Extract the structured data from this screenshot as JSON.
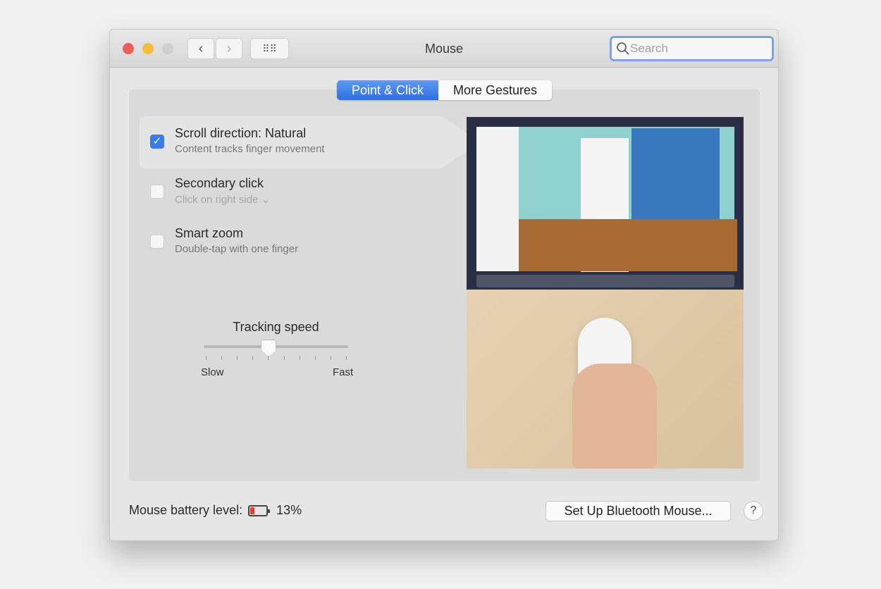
{
  "window": {
    "title": "Mouse",
    "search_placeholder": "Search"
  },
  "tabs": [
    {
      "label": "Point & Click",
      "selected": true
    },
    {
      "label": "More Gestures",
      "selected": false
    }
  ],
  "options": [
    {
      "title": "Scroll direction: Natural",
      "subtitle": "Content tracks finger movement",
      "checked": true
    },
    {
      "title": "Secondary click",
      "subtitle": "Click on right side",
      "chevron": "⌄",
      "checked": false
    },
    {
      "title": "Smart zoom",
      "subtitle": "Double-tap with one finger",
      "checked": false
    }
  ],
  "tracking": {
    "label": "Tracking speed",
    "min_label": "Slow",
    "max_label": "Fast",
    "value_fraction": 0.45,
    "ticks": 10
  },
  "footer": {
    "battery_label": "Mouse battery level:",
    "battery_percent": "13%",
    "battery_level": 0.13,
    "setup_button": "Set Up Bluetooth Mouse...",
    "help": "?"
  },
  "colors": {
    "accent": "#3b7ce6",
    "close": "#ec5f57",
    "minimize": "#f4be3c",
    "battery": "#e83a30"
  }
}
